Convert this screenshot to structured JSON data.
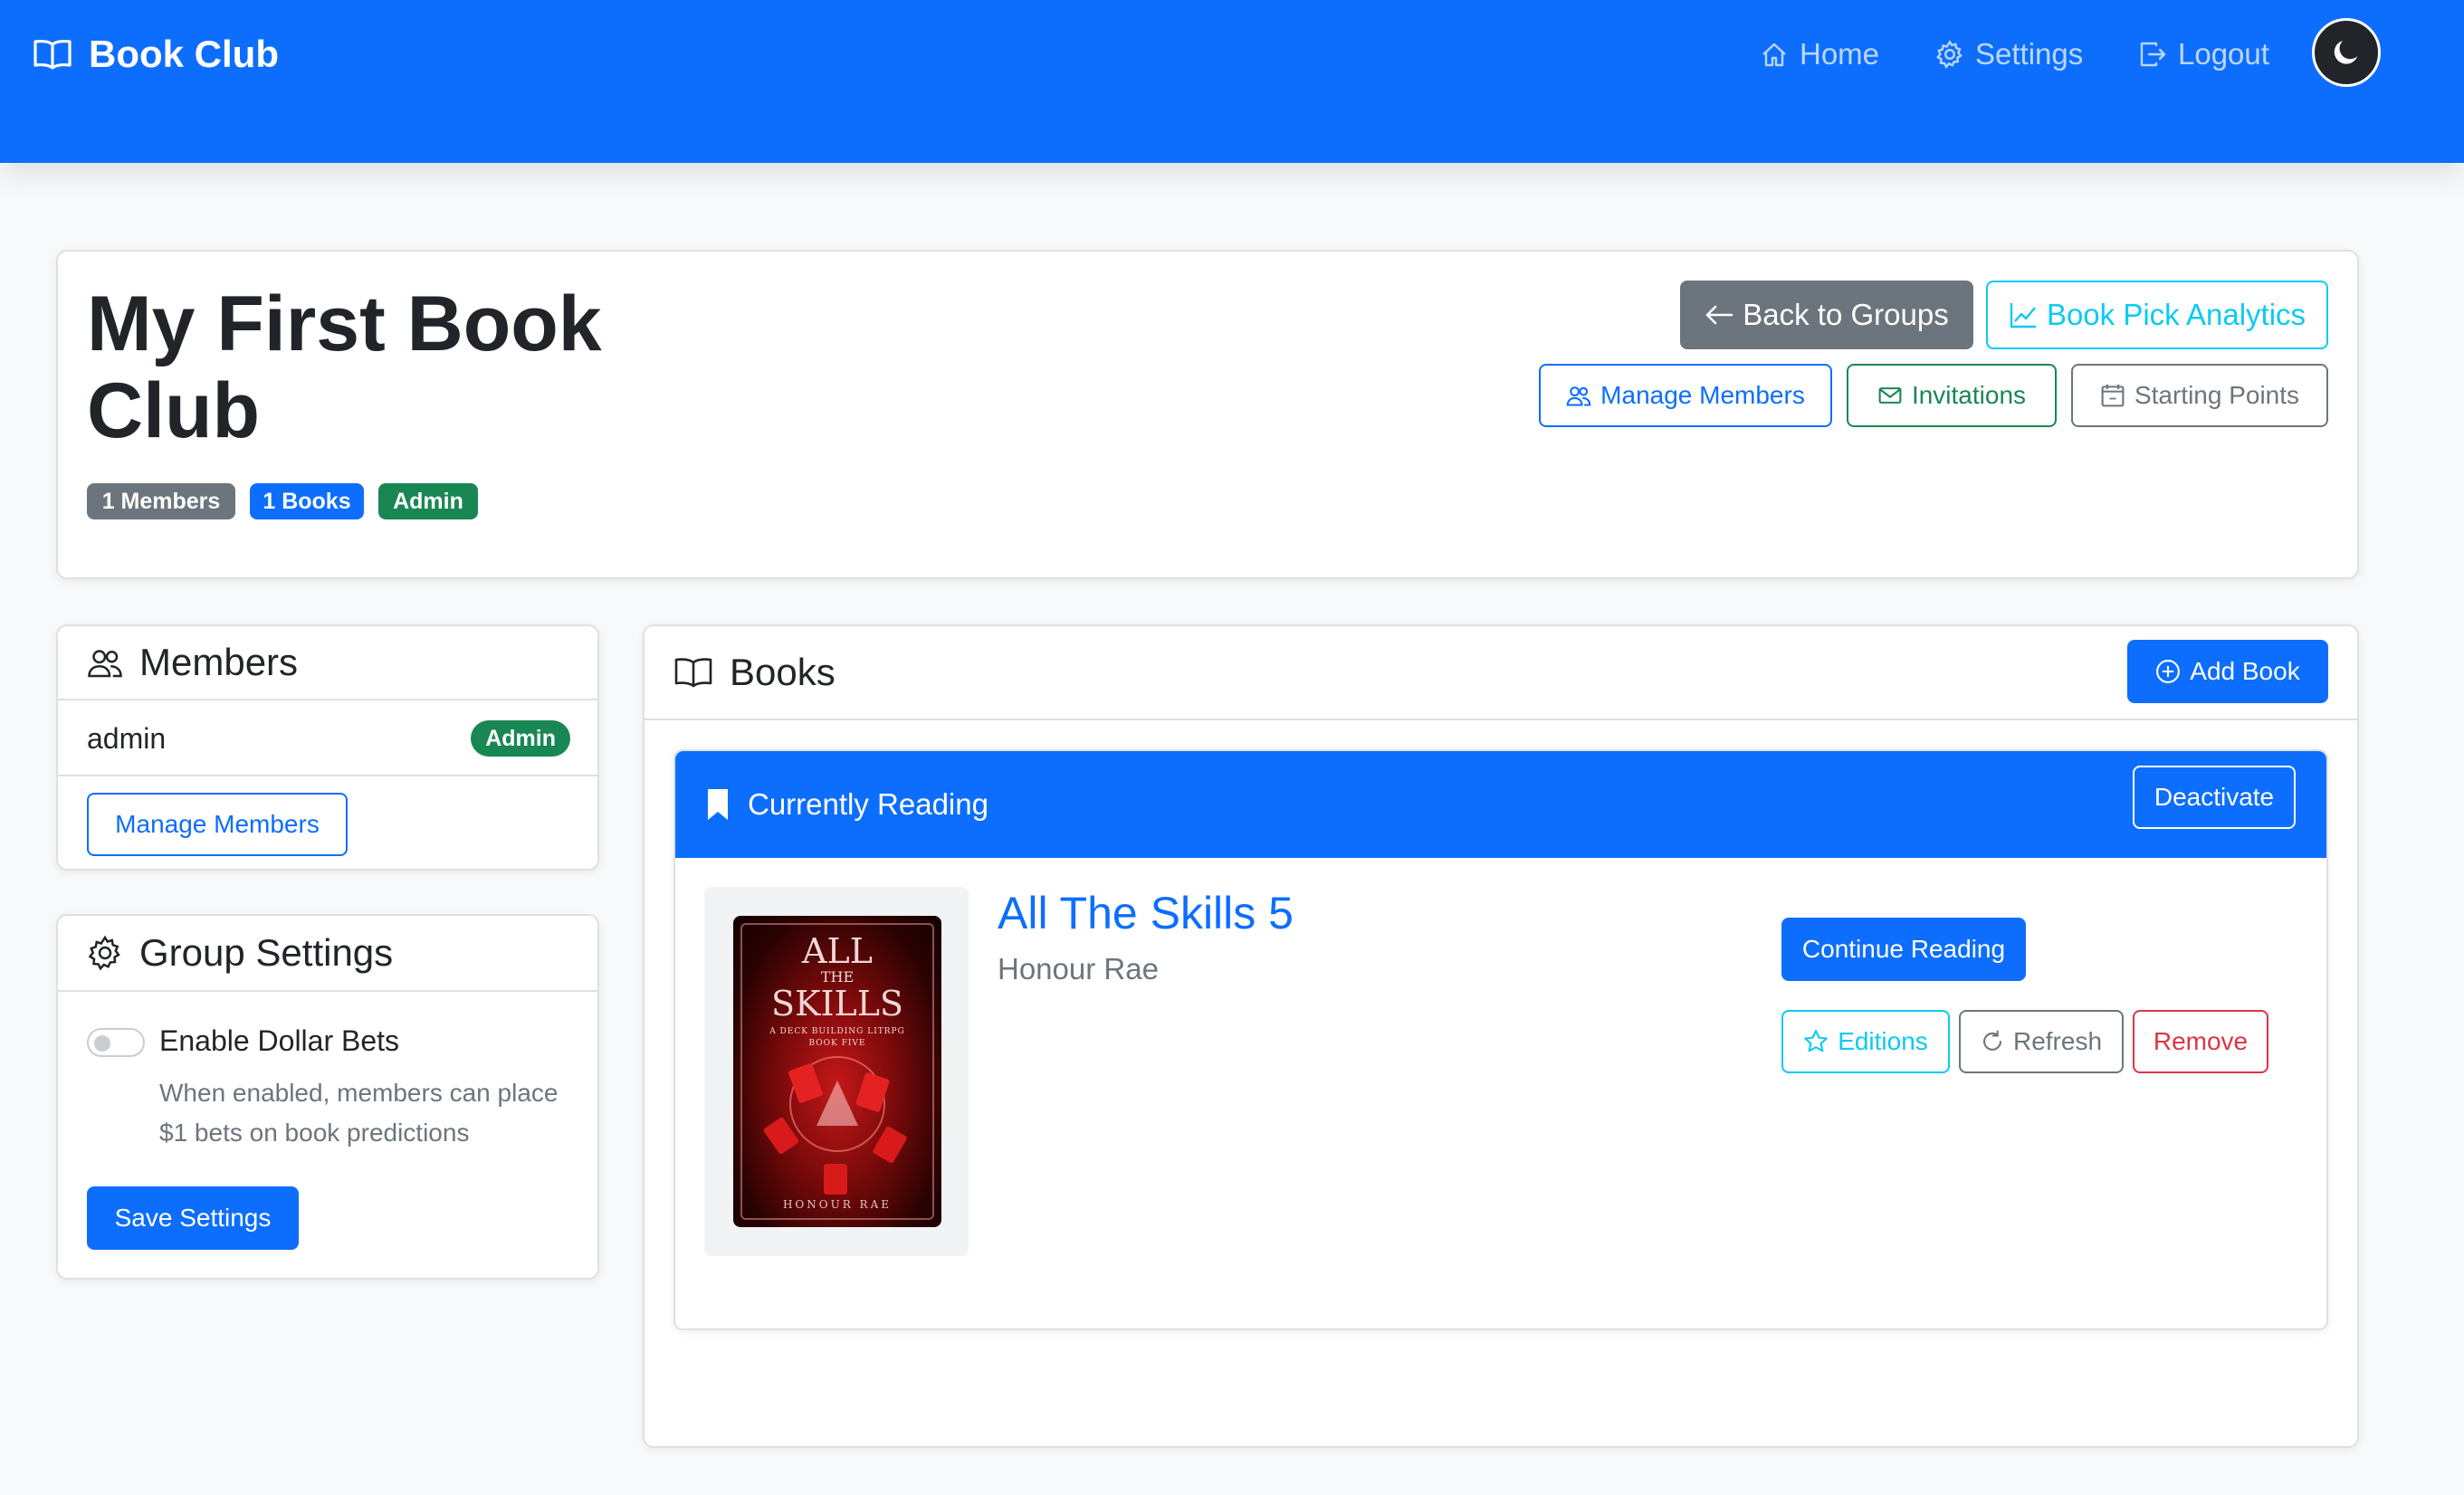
{
  "navbar": {
    "brand": "Book Club",
    "links": {
      "home": "Home",
      "settings": "Settings",
      "logout": "Logout"
    }
  },
  "group": {
    "title": "My First Book Club",
    "badges": {
      "members": "1 Members",
      "books": "1 Books",
      "role": "Admin"
    },
    "actions": {
      "back": "Back to Groups",
      "analytics": "Book Pick Analytics",
      "manage_members": "Manage Members",
      "invitations": "Invitations",
      "starting_points": "Starting Points"
    }
  },
  "members_panel": {
    "title": "Members",
    "members": [
      {
        "name": "admin",
        "role": "Admin"
      }
    ],
    "manage_button": "Manage Members"
  },
  "settings_panel": {
    "title": "Group Settings",
    "toggle_label": "Enable Dollar Bets",
    "toggle_on": false,
    "help_line1": "When enabled, members can place",
    "help_line2": "$1 bets on book predictions",
    "save_button": "Save Settings"
  },
  "books_panel": {
    "title": "Books",
    "add_button": "Add Book",
    "current": {
      "header": "Currently Reading",
      "deactivate_button": "Deactivate",
      "book": {
        "title": "All The Skills 5",
        "author": "Honour Rae",
        "cover_line1": "ALL",
        "cover_line2": "THE",
        "cover_line3": "SKILLS",
        "cover_tagline1": "A DECK BUILDING LITRPG",
        "cover_tagline2": "BOOK FIVE",
        "cover_author": "HONOUR RAE"
      },
      "actions": {
        "continue": "Continue Reading",
        "editions": "Editions",
        "refresh": "Refresh",
        "remove": "Remove"
      }
    }
  },
  "colors": {
    "primary": "#0d6efd",
    "secondary": "#6c757d",
    "success": "#198754",
    "info": "#0dcaf0",
    "danger": "#dc3545",
    "dark": "#212529"
  }
}
